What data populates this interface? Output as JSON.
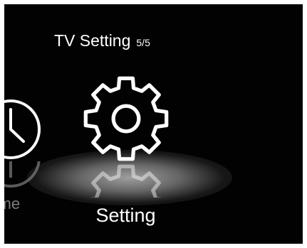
{
  "header": {
    "title": "TV Setting",
    "counter": "5/5"
  },
  "carousel": {
    "selected": {
      "label": "Setting",
      "icon": "gear-icon"
    },
    "previous": {
      "label": "Time",
      "icon": "clock-icon"
    }
  },
  "colors": {
    "background": "#020202",
    "text": "#ffffff",
    "dim_text": "#7d7d7d"
  }
}
